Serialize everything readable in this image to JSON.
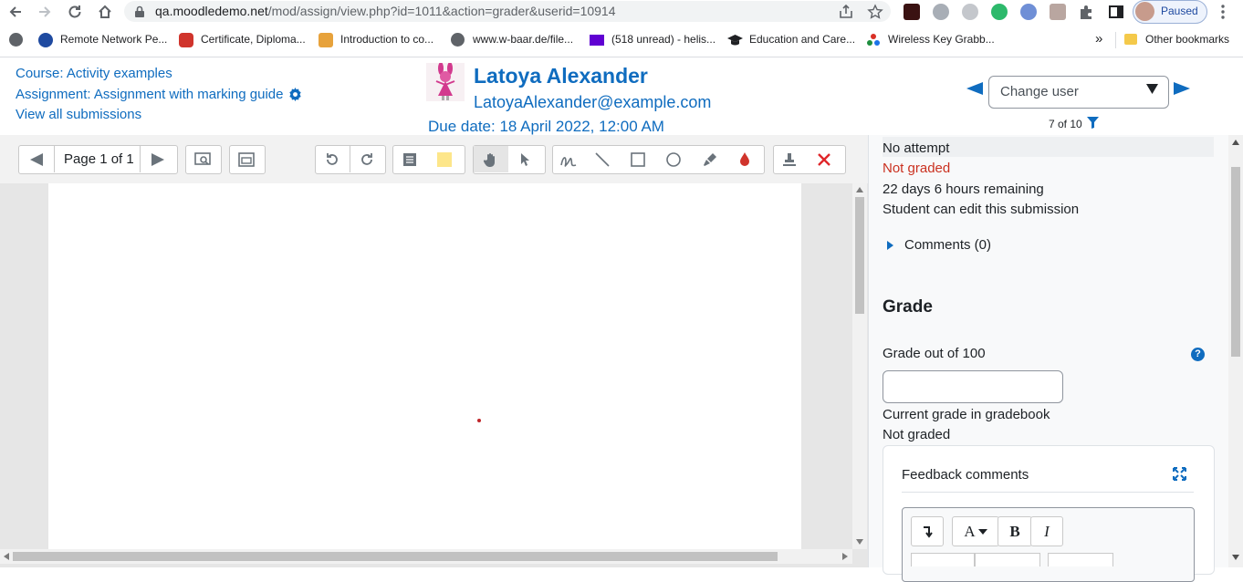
{
  "browser": {
    "url_host": "qa.moodledemo.net",
    "url_path": "/mod/assign/view.php?id=1011&action=grader&userid=10914",
    "profile_status": "Paused",
    "bookmarks": [
      {
        "label": "Remote Network Pe...",
        "icon": "s-circle-icon"
      },
      {
        "label": "Certificate, Diploma...",
        "icon": "badge-icon"
      },
      {
        "label": "Introduction to co...",
        "icon": "course-icon"
      },
      {
        "label": "www.w-baar.de/file...",
        "icon": "globe-icon"
      },
      {
        "label": "(518 unread) - helis...",
        "icon": "mail-icon"
      },
      {
        "label": "Education and Care...",
        "icon": "graduation-cap-icon"
      },
      {
        "label": "Wireless Key Grabb...",
        "icon": "dots-icon"
      }
    ],
    "overflow": "»",
    "other_bookmarks": "Other bookmarks"
  },
  "header": {
    "course_link": "Course: Activity examples",
    "assignment_link": "Assignment: Assignment with marking guide",
    "all_submissions_link": "View all submissions",
    "user_name": "Latoya Alexander",
    "user_email": "LatoyaAlexander@example.com",
    "due_date": "Due date: 18 April 2022, 12:00 AM",
    "change_user_placeholder": "Change user",
    "user_count": "7 of 10"
  },
  "toolbar": {
    "page_label": "Page 1 of 1"
  },
  "status": {
    "submission": "No attempt",
    "grading": "Not graded",
    "time_remaining": "22 days 6 hours remaining",
    "edit_status": "Student can edit this submission",
    "comments_link": "Comments (0)"
  },
  "grade": {
    "heading": "Grade",
    "grade_label": "Grade out of 100",
    "grade_value": "",
    "gradebook_label": "Current grade in gradebook",
    "gradebook_value": "Not graded",
    "feedback_label": "Feedback comments"
  },
  "colors": {
    "link": "#0f6cbf",
    "not_graded": "#ca3120",
    "help": "#0f6cbf"
  }
}
